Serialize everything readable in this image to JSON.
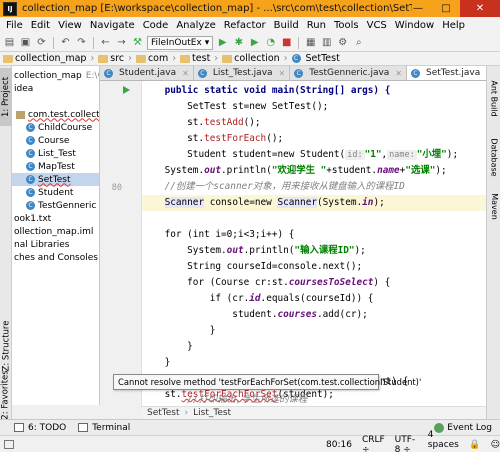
{
  "window": {
    "title": "collection_map [E:\\workspace\\collection_map] - ...\\src\\com\\test\\collection\\SetTest.java [colle",
    "app_icon_text": "IJ",
    "minimize": "—",
    "maximize": "□",
    "close": "✕"
  },
  "menu": [
    "File",
    "Edit",
    "View",
    "Navigate",
    "Code",
    "Analyze",
    "Refactor",
    "Build",
    "Run",
    "Tools",
    "VCS",
    "Window",
    "Help"
  ],
  "toolbar": {
    "run_config": "FileInOutEx"
  },
  "breadcrumb": [
    "collection_map",
    "src",
    "com",
    "test",
    "collection",
    "SetTest"
  ],
  "left_tools": {
    "project": "1: Project",
    "structure": "Z: Structure",
    "favorites": "2: Favorites"
  },
  "right_tools": {
    "ant": "Ant Build",
    "database": "Database",
    "maven": "Maven"
  },
  "project_tree": [
    {
      "label": "collection_map",
      "extra": "E:\\worksp",
      "kind": "plain"
    },
    {
      "label": "idea",
      "kind": "plain"
    },
    {
      "label": "",
      "kind": "plain"
    },
    {
      "label": "com.test.collection",
      "kind": "pkg"
    },
    {
      "label": "ChildCourse",
      "kind": "class"
    },
    {
      "label": "Course",
      "kind": "class"
    },
    {
      "label": "List_Test",
      "kind": "class"
    },
    {
      "label": "MapTest",
      "kind": "class"
    },
    {
      "label": "SetTest",
      "kind": "class",
      "selected": true
    },
    {
      "label": "Student",
      "kind": "class"
    },
    {
      "label": "TestGenneric",
      "kind": "class"
    },
    {
      "label": "ook1.txt",
      "kind": "plain"
    },
    {
      "label": "ollection_map.iml",
      "kind": "plain"
    },
    {
      "label": "nal Libraries",
      "kind": "plain"
    },
    {
      "label": "ches and Consoles",
      "kind": "plain"
    }
  ],
  "tabs": [
    {
      "label": "Student.java",
      "active": false
    },
    {
      "label": "List_Test.java",
      "active": false
    },
    {
      "label": "TestGenneric.java",
      "active": false
    },
    {
      "label": "SetTest.java",
      "active": true
    }
  ],
  "code": {
    "l1a": "    public static void main(String[] args) {",
    "l2": "        SetTest st=new SetTest();",
    "l3a": "        st.",
    "l3m": "testAdd",
    "l3b": "();",
    "l4a": "        st.",
    "l4m": "testForEach",
    "l4b": "();",
    "l5a": "        Student student=new Student(",
    "l5h1": "id:",
    "l5s1": "\"1\"",
    "l5c": ",",
    "l5h2": "name:",
    "l5s2": "\"小埋\"",
    "l5b": ");",
    "l6a": "    System.",
    "l6f": "out",
    "l6b": ".println(",
    "l6s1": "\"欢迎学生 \"",
    "l6c": "+student.",
    "l6f2": "name",
    "l6d": "+",
    "l6s2": "\"选课\"",
    "l6e": ");",
    "l7": "    //创建一个scanner对象，用来接收从键盘输入的课程ID",
    "l8a": "    ",
    "l8w1": "Scanner",
    "l8b": " console=new ",
    "l8w2": "Scanner",
    "l8c": "(System.",
    "l8f": "in",
    "l8d": ");",
    "l9": "",
    "l10": "    for (int i=0;i<3;i++) {",
    "l11a": "        System.",
    "l11f": "out",
    "l11b": ".println(",
    "l11s": "\"输入课程ID\"",
    "l11c": ");",
    "l12": "        String courseId=console.next();",
    "l13a": "        for (Course cr:st.",
    "l13f": "coursesToSelect",
    "l13b": ") {",
    "l14a": "            if (cr.",
    "l14f": "id",
    "l14b": ".equals(courseId)) {",
    "l15a": "                student.",
    "l15f": "courses",
    "l15b": ".add(cr);",
    "l16": "            }",
    "l17": "        }",
    "l18": "    }",
    "l19": "",
    "l20a": "    st.",
    "l20m": "testForEachForSet",
    "l20b": "(student);",
    "behind": "nt) {",
    "l23": "        //打印输出,学生所选的课程"
  },
  "line_numbers": {
    "current": "80"
  },
  "tooltip": "Cannot resolve method 'testForEachForSet(com.test.collection.Student)'",
  "editor_crumbs": [
    "SetTest",
    "List_Test"
  ],
  "bottom_tabs": {
    "todo": "6: TODO",
    "terminal": "Terminal",
    "event_log": "Event Log"
  },
  "status": {
    "position": "80:16",
    "line_sep": "CRLF ÷",
    "encoding": "UTF-8 ÷",
    "indent": "4 spaces ÷"
  }
}
